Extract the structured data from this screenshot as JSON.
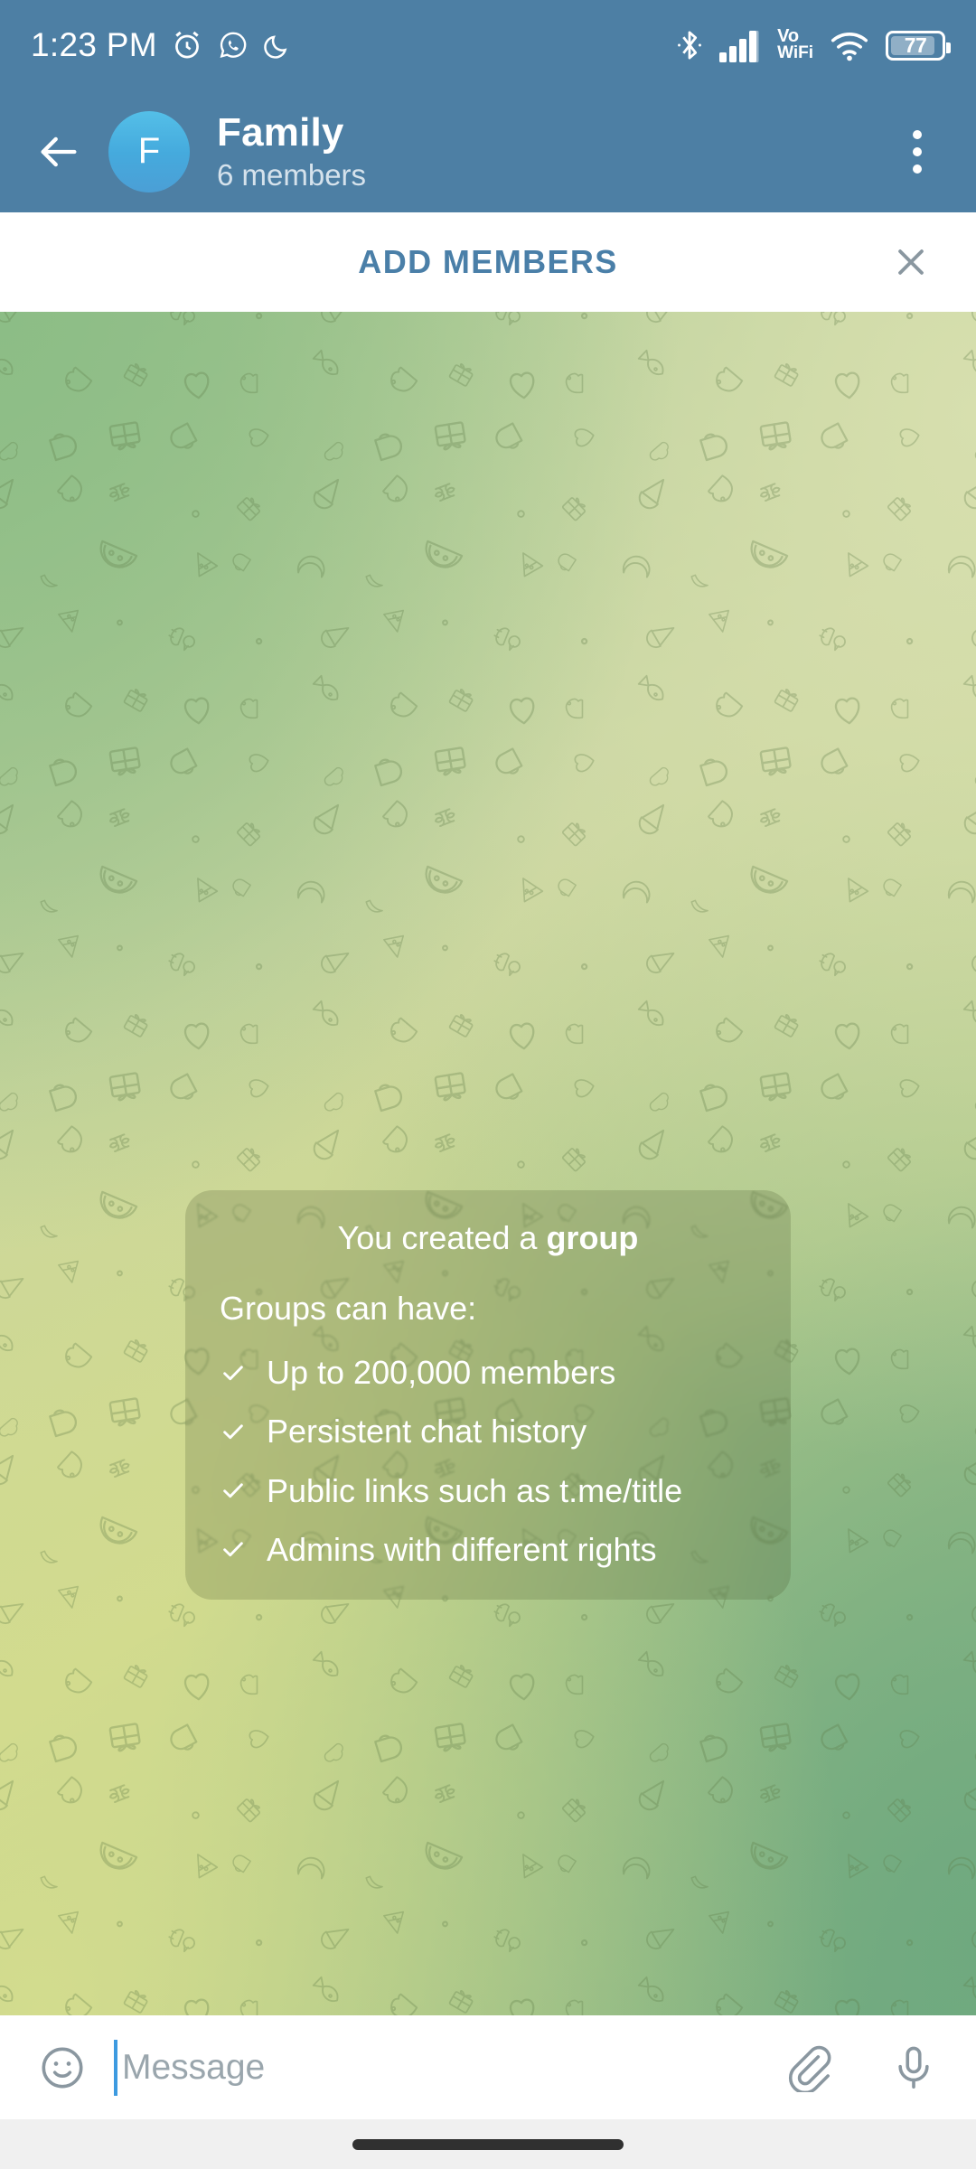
{
  "status_bar": {
    "time": "1:23 PM",
    "battery_level": "77",
    "vowifi_top": "Vo",
    "vowifi_bottom": "WiFi",
    "left_icons": [
      "alarm-clock-icon",
      "whatsapp-icon",
      "do-not-disturb-moon-icon"
    ],
    "right_icons": [
      "bluetooth-icon",
      "cellular-signal-icon",
      "vowifi-indicator",
      "wifi-icon",
      "battery-icon"
    ]
  },
  "header": {
    "back_icon": "back-arrow-icon",
    "avatar_initial": "F",
    "title": "Family",
    "subtitle": "6 members",
    "menu_icon": "overflow-menu-icon",
    "background_color": "#4d7fa4",
    "avatar_color": "#49b4e4"
  },
  "add_members_bar": {
    "label": "ADD MEMBERS",
    "label_color": "#4a7fa8",
    "close_icon": "close-icon"
  },
  "info_card": {
    "title_prefix": "You created a ",
    "title_bold": "group",
    "subtitle": "Groups can have:",
    "bullets": [
      {
        "check": "check-icon",
        "text": "Up to 200,000 members"
      },
      {
        "check": "check-icon",
        "text": "Persistent chat history"
      },
      {
        "check": "check-icon",
        "text": "Public links such as t.me/title"
      },
      {
        "check": "check-icon",
        "text": "Admins with different rights"
      }
    ]
  },
  "composer": {
    "emoji_icon": "emoji-smiley-icon",
    "placeholder": "Message",
    "attach_icon": "paperclip-icon",
    "mic_icon": "microphone-icon",
    "caret_color": "#3d9ae0"
  },
  "nav_bar": {
    "gesture_pill": "home-gesture-pill"
  }
}
